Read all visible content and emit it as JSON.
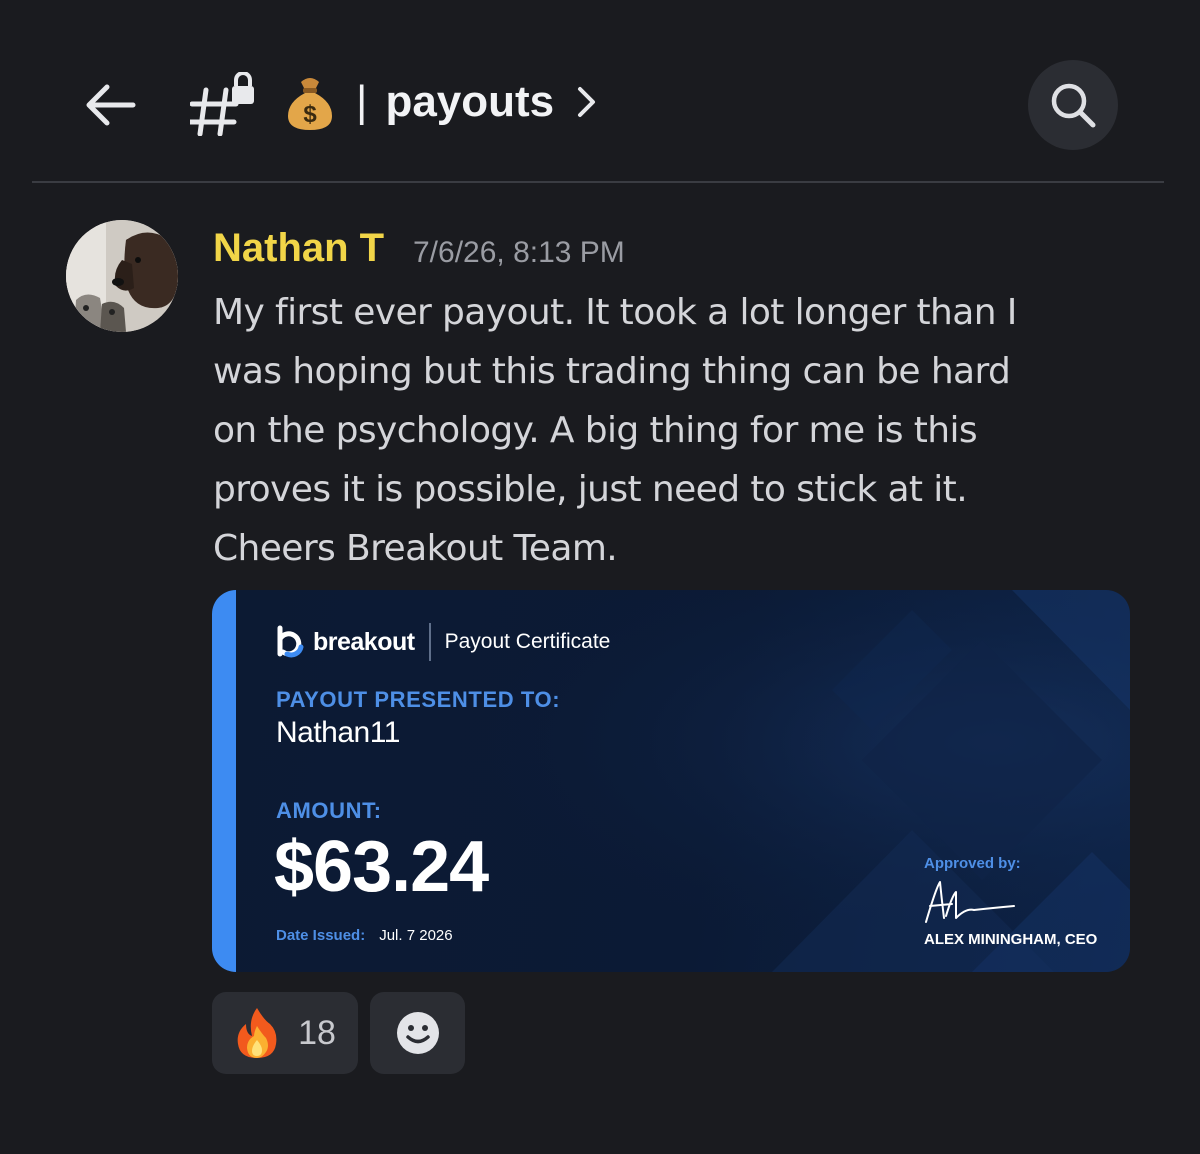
{
  "header": {
    "channel_name": "payouts",
    "separator": "|",
    "back_icon": "arrow-left-icon",
    "channel_icon": "locked-channel-hash-icon",
    "channel_emoji": "money-bag-icon",
    "search_icon": "search-icon"
  },
  "message": {
    "author": "Nathan T",
    "author_color": "#f1d548",
    "timestamp": "7/6/26, 8:13 PM",
    "text_lines": [
      "My first ever payout. It took a lot longer than I",
      "was hoping but this trading thing can be hard",
      "on the psychology. A big thing for me is this",
      "proves it is possible, just need to stick at it.",
      "Cheers Breakout Team."
    ]
  },
  "certificate": {
    "brand": "breakout",
    "type": "Payout Certificate",
    "presented_label": "PAYOUT PRESENTED TO:",
    "recipient": "Nathan11",
    "amount_label": "AMOUNT:",
    "amount": "$63.24",
    "date_label": "Date Issued:",
    "date": "Jul. 7 2026",
    "approved_label": "Approved by:",
    "signer": "ALEX MININGHAM, CEO",
    "accent_color": "#3d8bf2"
  },
  "reactions": [
    {
      "icon": "fire-icon",
      "count": "18"
    },
    {
      "icon": "add-reaction-icon",
      "count": ""
    }
  ],
  "colors": {
    "background": "#1a1b1f",
    "surface": "#2b2d33",
    "label_blue": "#4e8fe6"
  }
}
